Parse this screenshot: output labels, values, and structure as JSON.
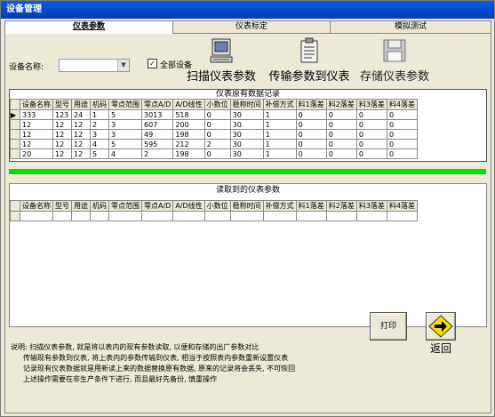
{
  "window": {
    "title": "设备管理"
  },
  "tabs": [
    {
      "label": "仪表参数",
      "active": true
    },
    {
      "label": "仪表标定",
      "active": false
    },
    {
      "label": "模拟测试",
      "active": false
    }
  ],
  "filter": {
    "device_name_label": "设备名称:",
    "device_name_value": "",
    "all_devices_label": "全部设备",
    "all_devices_checked": true
  },
  "actions": {
    "scan_label": "扫描仪表参数",
    "transfer_label": "传输参数到仪表",
    "save_label": "存储仪表参数",
    "print_label": "打印",
    "back_label": "返回"
  },
  "icons": {
    "scan": "computer-icon",
    "transfer": "clipboard-icon",
    "save": "floppy-disk-icon",
    "back": "arrow-right-icon"
  },
  "colors": {
    "title_bar": "#0346c6",
    "divider": "#00e000"
  },
  "existing_table": {
    "title": "仪表原有数据记录",
    "columns": [
      "设备名称",
      "型号",
      "用途",
      "机码",
      "零点范围",
      "零点A/D",
      "A/D线性",
      "小数位",
      "稳称时间",
      "补偿方式",
      "料1落差",
      "料2落差",
      "料3落差",
      "料4落差"
    ],
    "rows": [
      [
        "333",
        "123",
        "24",
        "1",
        "5",
        "3013",
        "518",
        "0",
        "30",
        "1",
        "0",
        "0",
        "0",
        "0"
      ],
      [
        "12",
        "12",
        "12",
        "2",
        "3",
        "607",
        "200",
        "0",
        "30",
        "1",
        "0",
        "0",
        "0",
        "0"
      ],
      [
        "12",
        "12",
        "12",
        "3",
        "3",
        "49",
        "198",
        "0",
        "30",
        "1",
        "0",
        "0",
        "0",
        "0"
      ],
      [
        "12",
        "12",
        "12",
        "4",
        "5",
        "595",
        "212",
        "2",
        "30",
        "1",
        "0",
        "0",
        "0",
        "0"
      ],
      [
        "20",
        "12",
        "12",
        "5",
        "4",
        "2",
        "198",
        "0",
        "30",
        "1",
        "0",
        "0",
        "0",
        "0"
      ]
    ]
  },
  "read_table": {
    "title": "读取到的仪表参数",
    "columns": [
      "设备名称",
      "型号",
      "用途",
      "机码",
      "零点范围",
      "零点A/D",
      "A/D线性",
      "小数位",
      "稳称时间",
      "补偿方式",
      "料1落差",
      "料2落差",
      "料3落差",
      "料4落差"
    ],
    "rows": [
      [
        "",
        "",
        "",
        "",
        "",
        "",
        "",
        "",
        "",
        "",
        "",
        "",
        "",
        ""
      ]
    ]
  },
  "notes": [
    "说明: 扫描仪表参数, 就是将以表内的现有参数读取, 以便和存储的出厂参数对比",
    "传输现有参数到仪表, 将上表内的参数传输到仪表, 相当于按照表内参数重新设置仪表",
    "记录现有仪表数据就是用新读上来的数据替换原有数据, 原来的记录将会丢失, 不可恢回",
    "上述操作需要在非生产条件下进行, 而且最好先备份, 慎重操作"
  ]
}
